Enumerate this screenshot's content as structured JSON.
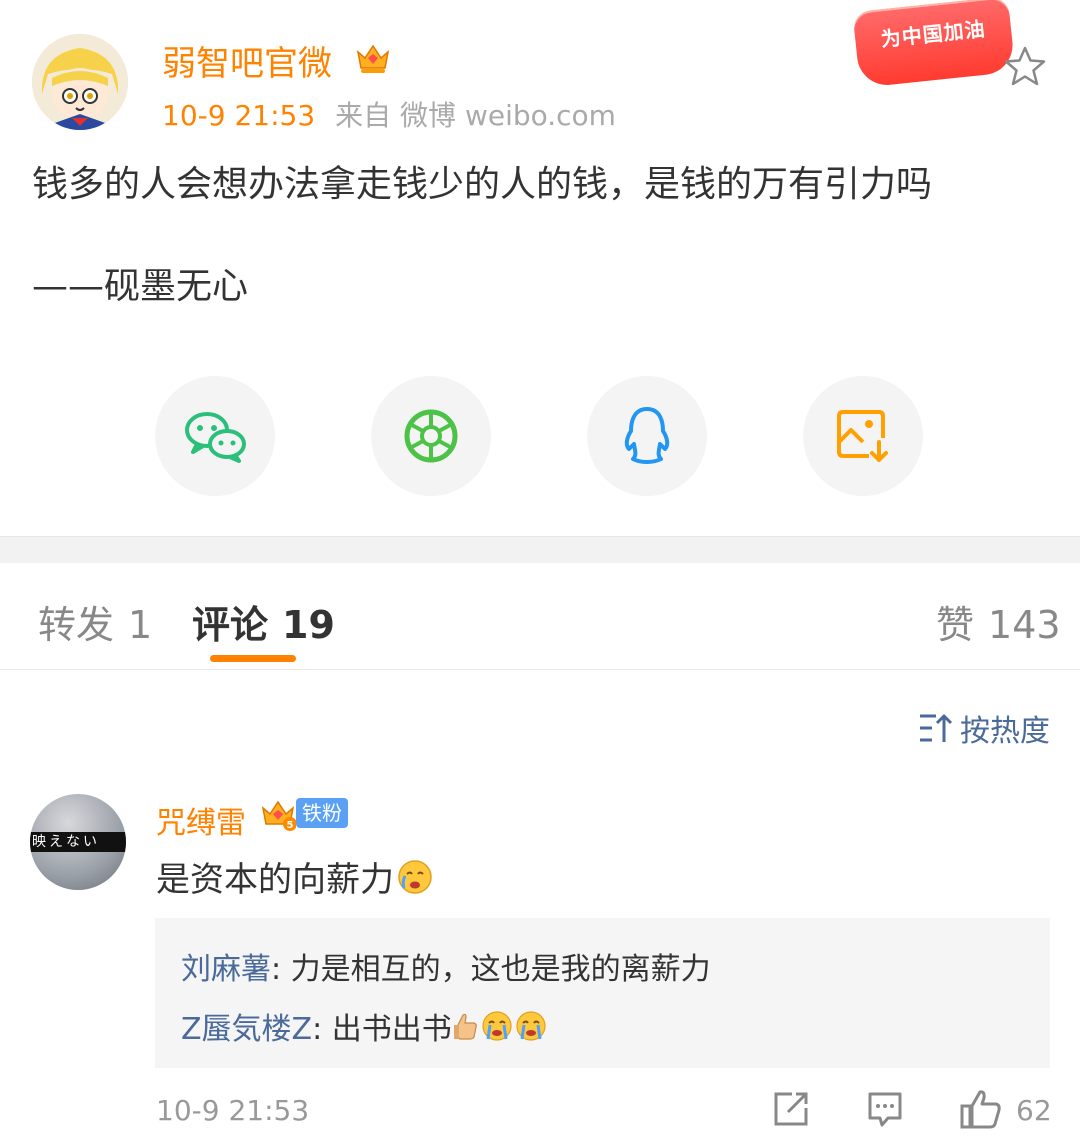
{
  "post": {
    "author": "弱智吧官微",
    "time": "10-9 21:53",
    "source": "来自 微博 weibo.com",
    "badge": "为中国加油",
    "text_line1": "钱多的人会想办法拿走钱少的人的钱，是钱的万有引力吗",
    "text_line2": "——砚墨无心"
  },
  "share_icons": [
    "wechat-icon",
    "moments-icon",
    "qq-icon",
    "save-image-icon"
  ],
  "tabs": {
    "repost_label": "转发",
    "repost_count": "1",
    "comment_label": "评论",
    "comment_count": "19",
    "like_label": "赞",
    "like_count": "143"
  },
  "sort": {
    "label": "按热度"
  },
  "comment": {
    "author": "咒缚雷",
    "fan_badge": "铁粉",
    "avatar_text": "映えない",
    "text": "是资本的向薪力",
    "replies": [
      {
        "name": "刘麻薯",
        "text": ": 力是相互的，这也是我的离薪力"
      },
      {
        "name": "Z蜃気楼Z",
        "text": ": 出书出书"
      }
    ],
    "time": "10-9 21:53",
    "likes": "62"
  },
  "colors": {
    "accent": "#ff8200",
    "link": "#4a6a9a",
    "fan_badge": "#5aa0f5"
  }
}
